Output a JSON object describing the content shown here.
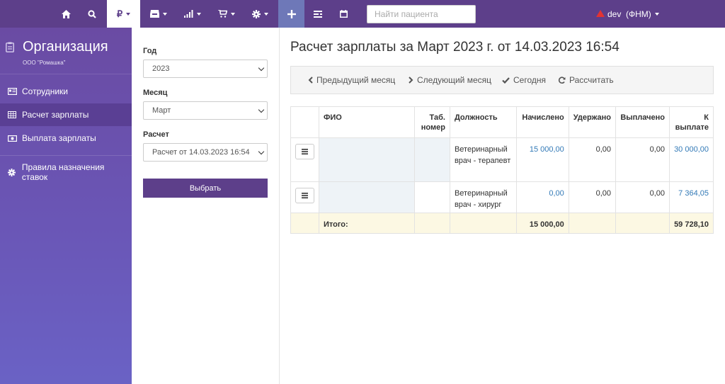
{
  "topbar": {
    "search_placeholder": "Найти пациента",
    "user_label": "dev  (ФНМ)"
  },
  "sidebar": {
    "title": "Организация",
    "subtitle": "ООО \"Ромашка\"",
    "items": [
      {
        "label": "Сотрудники"
      },
      {
        "label": "Расчет зарплаты"
      },
      {
        "label": "Выплата зарплаты"
      },
      {
        "label": "Правила назначения ставок"
      }
    ]
  },
  "filter": {
    "year_label": "Год",
    "year_value": "2023",
    "month_label": "Месяц",
    "month_value": "Март",
    "calc_label": "Расчет",
    "calc_value": "Расчет от 14.03.2023 16:54",
    "submit_label": "Выбрать"
  },
  "main": {
    "title": "Расчет зарплаты за Март 2023 г. от 14.03.2023 16:54",
    "toolbar": {
      "prev": "Предыдущий месяц",
      "next": "Следующий месяц",
      "today": "Сегодня",
      "recalc": "Рассчитать"
    }
  },
  "table": {
    "headers": {
      "fio": "ФИО",
      "tab_line1": "Таб.",
      "tab_line2": "номер",
      "position": "Должность",
      "accrued": "Начислено",
      "withheld": "Удержано",
      "paid": "Выплачено",
      "payout_line1": "К",
      "payout_line2": "выплате"
    },
    "rows": [
      {
        "position_line1": "Ветеринарный",
        "position_line2": "врач - терапевт",
        "accrued": "15 000,00",
        "withheld": "0,00",
        "paid": "0,00",
        "payout": "30 000,00"
      },
      {
        "position_line1": "Ветеринарный",
        "position_line2": "врач - хирург",
        "accrued": "0,00",
        "withheld": "0,00",
        "paid": "0,00",
        "payout": "7 364,05"
      }
    ],
    "total": {
      "label": "Итого:",
      "accrued": "15 000,00",
      "payout": "59 728,10"
    }
  },
  "colors": {
    "brand": "#5d3f8a",
    "link": "#337ab7",
    "total_row": "#fcf8e3"
  }
}
